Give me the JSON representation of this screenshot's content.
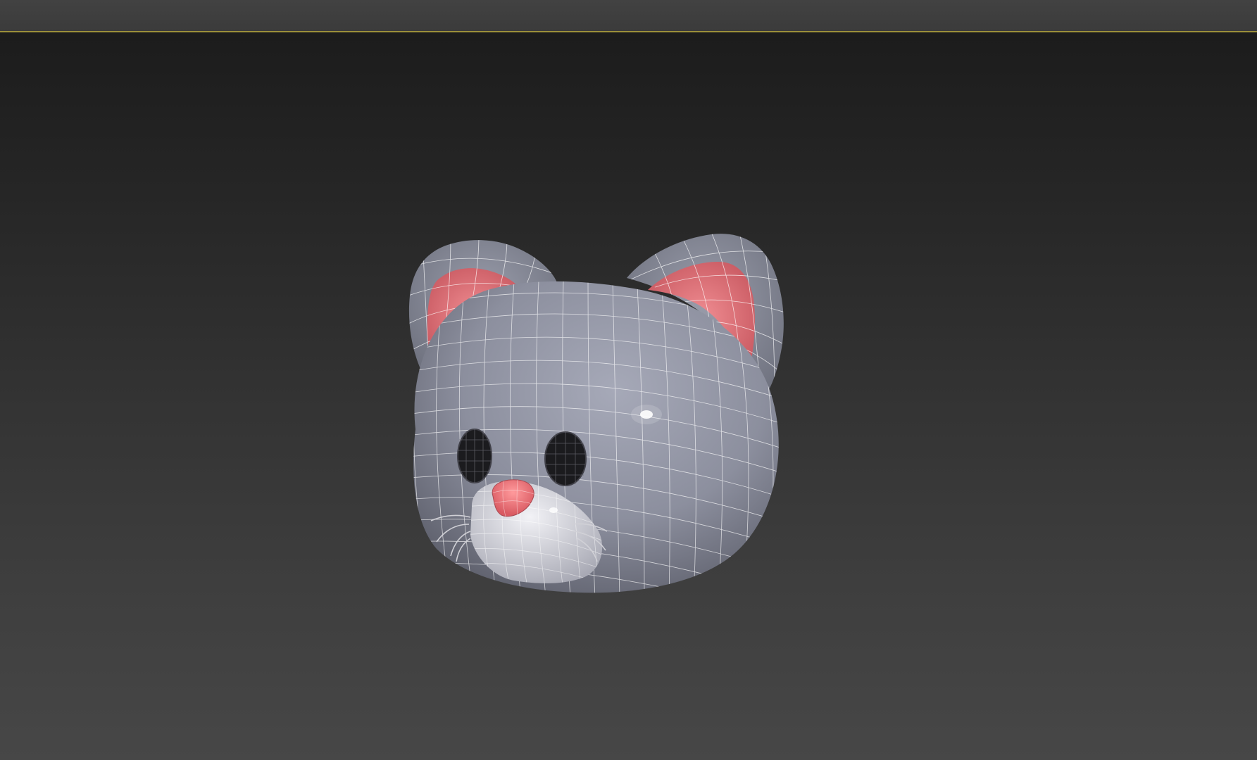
{
  "app": {
    "viewport": {
      "label": "",
      "shading_mode": "smooth-highlights-edged-faces",
      "active_border_color": "#9b8f3a",
      "background_top": "#1c1c1c",
      "background_bottom": "#474747"
    },
    "scene": {
      "object": "cartoon-mouse-head",
      "colors": {
        "body": "#8c8f9e",
        "ear_inner": "#e67a80",
        "nose": "#e8696f",
        "muzzle": "#d8d8e0",
        "eyes": "#1a1a1c",
        "wireframe": "#ffffff"
      }
    }
  }
}
